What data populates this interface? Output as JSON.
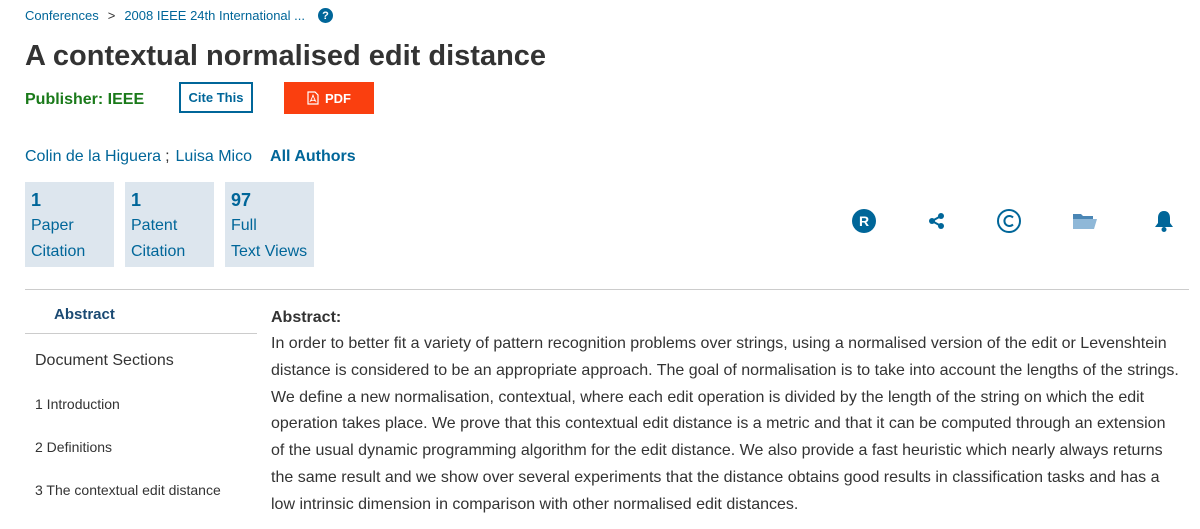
{
  "breadcrumb": {
    "items": [
      "Conferences",
      "2008 IEEE 24th International ..."
    ],
    "separator": ">",
    "help_glyph": "?"
  },
  "title": "A contextual normalised edit distance",
  "publisher": {
    "label": "Publisher: IEEE"
  },
  "buttons": {
    "cite": "Cite This",
    "pdf": "PDF"
  },
  "authors": {
    "names": [
      "Colin de la Higuera",
      "Luisa Mico"
    ],
    "separator": ";",
    "all_authors_label": "All Authors"
  },
  "metrics": [
    {
      "value": "1",
      "line1": "Paper",
      "line2": "Citation"
    },
    {
      "value": "1",
      "line1": "Patent",
      "line2": "Citation"
    },
    {
      "value": "97",
      "line1": "Full",
      "line2": "Text Views"
    }
  ],
  "action_icons": [
    "rights-permissions-icon",
    "share-icon",
    "copyright-icon",
    "folder-icon",
    "alerts-bell-icon"
  ],
  "sidebar": {
    "abstract_label": "Abstract",
    "document_sections_label": "Document Sections",
    "sections": [
      "1 Introduction",
      "2 Definitions",
      "3 The contextual edit distance"
    ]
  },
  "abstract": {
    "heading": "Abstract:",
    "text": "In order to better fit a variety of pattern recognition problems over strings, using a normalised version of the edit or Levenshtein distance is considered to be an appropriate approach. The goal of normalisation is to take into account the lengths of the strings. We define a new normalisation, contextual, where each edit operation is divided by the length of the string on which the edit operation takes place. We prove that this contextual edit distance is a metric and that it can be computed through an extension of the usual dynamic programming algorithm for the edit distance. We also provide a fast heuristic which nearly always returns the same result and we show over several experiments that the distance obtains good results in classification tasks and has a low intrinsic dimension in comparison with other normalised edit distances."
  },
  "colors": {
    "link": "#006699",
    "pdf_button": "#fa3f0f",
    "publisher": "#1a7a1a",
    "metric_bg": "#dde6ee"
  }
}
